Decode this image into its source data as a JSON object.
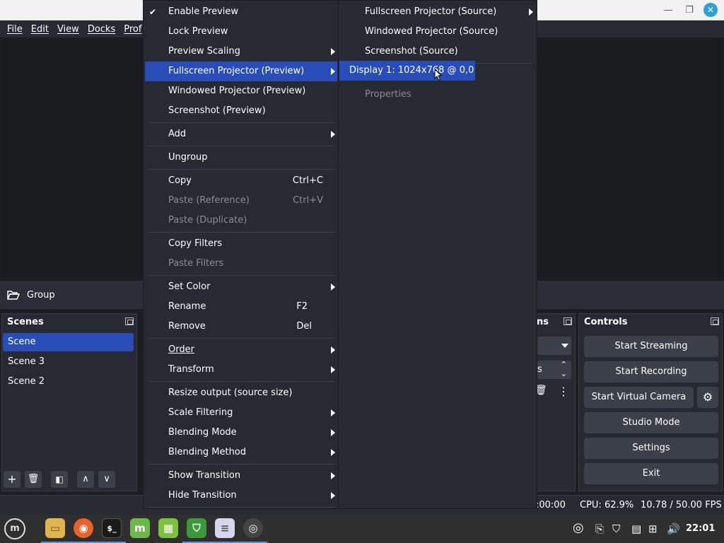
{
  "menubar": {
    "items": [
      "File",
      "Edit",
      "View",
      "Docks",
      "Prof"
    ]
  },
  "source_bar": {
    "label": "Group"
  },
  "scenes": {
    "title": "Scenes",
    "items": [
      "Scene",
      "Scene 3",
      "Scene 2"
    ]
  },
  "sources_dock": {
    "title": "ns",
    "field_text": "s"
  },
  "controls": {
    "title": "Controls",
    "start_streaming": "Start Streaming",
    "start_recording": "Start Recording",
    "start_virtual_camera": "Start Virtual Camera",
    "studio_mode": "Studio Mode",
    "settings": "Settings",
    "exit": "Exit"
  },
  "status": {
    "time": ":00:00",
    "cpu": "CPU: 62.9%",
    "fps": "10.78 / 50.00 FPS"
  },
  "taskbar": {
    "clock": "22:01"
  },
  "context_menu": {
    "enable_preview": "Enable Preview",
    "lock_preview": "Lock Preview",
    "preview_scaling": "Preview Scaling",
    "fullscreen_projector": "Fullscreen Projector (Preview)",
    "windowed_projector": "Windowed Projector (Preview)",
    "screenshot": "Screenshot (Preview)",
    "add": "Add",
    "ungroup": "Ungroup",
    "copy": "Copy",
    "copy_shortcut": "Ctrl+C",
    "paste_reference": "Paste (Reference)",
    "paste_reference_shortcut": "Ctrl+V",
    "paste_duplicate": "Paste (Duplicate)",
    "copy_filters": "Copy Filters",
    "paste_filters": "Paste Filters",
    "set_color": "Set Color",
    "rename": "Rename",
    "rename_shortcut": "F2",
    "remove": "Remove",
    "remove_shortcut": "Del",
    "order": "Order",
    "transform": "Transform",
    "resize_output": "Resize output (source size)",
    "scale_filtering": "Scale Filtering",
    "blending_mode": "Blending Mode",
    "blending_method": "Blending Method",
    "show_transition": "Show Transition",
    "hide_transition": "Hide Transition"
  },
  "source_menu": {
    "fullscreen_projector": "Fullscreen Projector (Source)",
    "windowed_projector": "Windowed Projector (Source)",
    "screenshot": "Screenshot (Source)",
    "properties": "Properties"
  },
  "display_submenu": {
    "display_1": "Display 1: 1024x768 @ 0,0"
  }
}
